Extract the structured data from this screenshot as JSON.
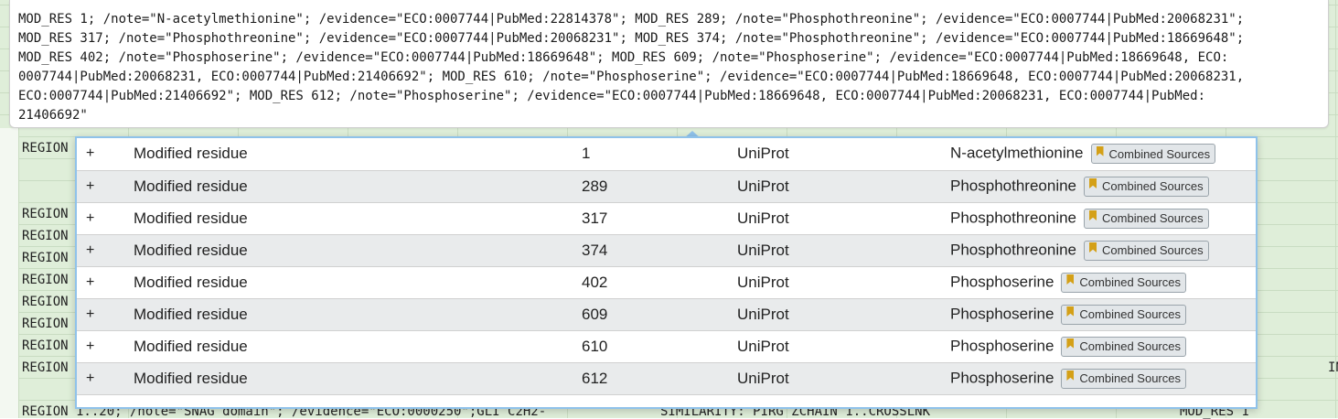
{
  "cell_tooltip": {
    "lines": [
      "MOD_RES 1; /note=\"N-acetylmethionine\"; /evidence=\"ECO:0007744|PubMed:22814378\"; MOD_RES 289; /note=\"Phosphothreonine\"; /evidence=\"ECO:0007744|PubMed:20068231\";",
      "MOD_RES 317; /note=\"Phosphothreonine\"; /evidence=\"ECO:0007744|PubMed:20068231\"; MOD_RES 374; /note=\"Phosphothreonine\"; /evidence=\"ECO:0007744|PubMed:18669648\";",
      "MOD_RES 402; /note=\"Phosphoserine\"; /evidence=\"ECO:0007744|PubMed:18669648\"; MOD_RES 609; /note=\"Phosphoserine\"; /evidence=\"ECO:0007744|PubMed:18669648, ECO:",
      "0007744|PubMed:20068231, ECO:0007744|PubMed:21406692\"; MOD_RES 610; /note=\"Phosphoserine\"; /evidence=\"ECO:0007744|PubMed:18669648, ECO:0007744|PubMed:20068231,",
      "ECO:0007744|PubMed:21406692\"; MOD_RES 612; /note=\"Phosphoserine\"; /evidence=\"ECO:0007744|PubMed:18669648, ECO:0007744|PubMed:20068231, ECO:0007744|PubMed:",
      "21406692\""
    ]
  },
  "sheet": {
    "region_label": "REGION",
    "bottom_row": {
      "col_a": "REGION 1..20; /note=\"SNAG domain\"; /evidence=\"ECO:0000250\";GLI C2H2-",
      "col_b": "SIMILARITY: PIRG ZCHAIN 1..CROSSLNK",
      "col_c": "MOD_RES 1"
    },
    "partial_right": "IN"
  },
  "features_popup": {
    "colors": {
      "border": "#8fc2ea",
      "row_alt": "#e9ebec",
      "bookmark": "#d4a017"
    },
    "expand_symbol": "+",
    "badge_label": "Combined Sources",
    "rows": [
      {
        "type": "Modified residue",
        "position": "1",
        "source": "UniProt",
        "description": "N-acetylmethionine"
      },
      {
        "type": "Modified residue",
        "position": "289",
        "source": "UniProt",
        "description": "Phosphothreonine"
      },
      {
        "type": "Modified residue",
        "position": "317",
        "source": "UniProt",
        "description": "Phosphothreonine"
      },
      {
        "type": "Modified residue",
        "position": "374",
        "source": "UniProt",
        "description": "Phosphothreonine"
      },
      {
        "type": "Modified residue",
        "position": "402",
        "source": "UniProt",
        "description": "Phosphoserine"
      },
      {
        "type": "Modified residue",
        "position": "609",
        "source": "UniProt",
        "description": "Phosphoserine"
      },
      {
        "type": "Modified residue",
        "position": "610",
        "source": "UniProt",
        "description": "Phosphoserine"
      },
      {
        "type": "Modified residue",
        "position": "612",
        "source": "UniProt",
        "description": "Phosphoserine"
      }
    ]
  }
}
